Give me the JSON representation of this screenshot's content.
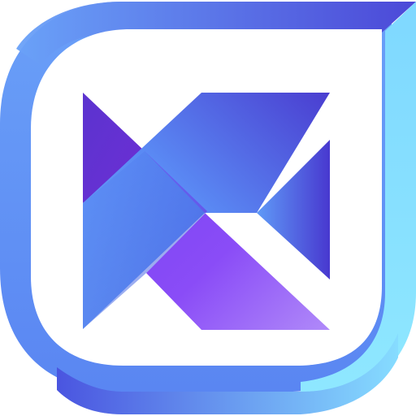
{
  "logo": {
    "name": "k-mark-logo",
    "colors": {
      "frame_blue": "#5f93f6",
      "frame_indigo": "#4c4fd8",
      "frame_cyan": "#8be6ff",
      "arm_purple": "#6a2fd0",
      "arm_violet": "#8a48f6",
      "arm_lilac": "#aa7bfb",
      "arm_blue": "#5794f6",
      "arm_indigo": "#4a3dd4",
      "background": "#ffffff"
    }
  }
}
